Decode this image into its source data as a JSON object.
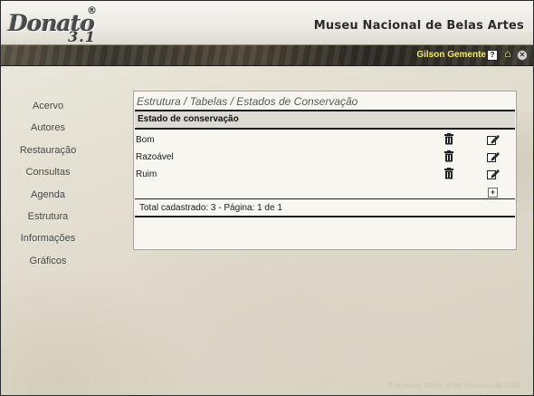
{
  "app": {
    "logo_word": "Donato",
    "logo_version": "3.1",
    "logo_mark": "®",
    "museum": "Museu Nacional de Belas Artes"
  },
  "userbar": {
    "user": "Gilson Gemente",
    "icons": [
      "help-icon",
      "home-icon",
      "close-icon"
    ]
  },
  "sidebar": {
    "items": [
      {
        "label": "Acervo"
      },
      {
        "label": "Autores"
      },
      {
        "label": "Restauração"
      },
      {
        "label": "Consultas"
      },
      {
        "label": "Agenda"
      },
      {
        "label": "Estrutura"
      },
      {
        "label": "Informações"
      },
      {
        "label": "Gráficos"
      }
    ]
  },
  "panel": {
    "breadcrumb": "Estrutura / Tabelas / Estados de Conservação",
    "column_header": "Estado de conservação",
    "rows": [
      {
        "label": "Bom"
      },
      {
        "label": "Razoável"
      },
      {
        "label": "Ruim"
      }
    ],
    "footer": "Total cadastrado: 3 - Página: 1 de 1"
  },
  "status": {
    "counter": "9 acessos desde 1º de fevereiro de 2008"
  },
  "colors": {
    "userbar_text": "#f2e56e",
    "userbar_bg": "#3b3830",
    "panel_bg": "#f7f6f1",
    "header_row_bg": "#dcdad2"
  }
}
